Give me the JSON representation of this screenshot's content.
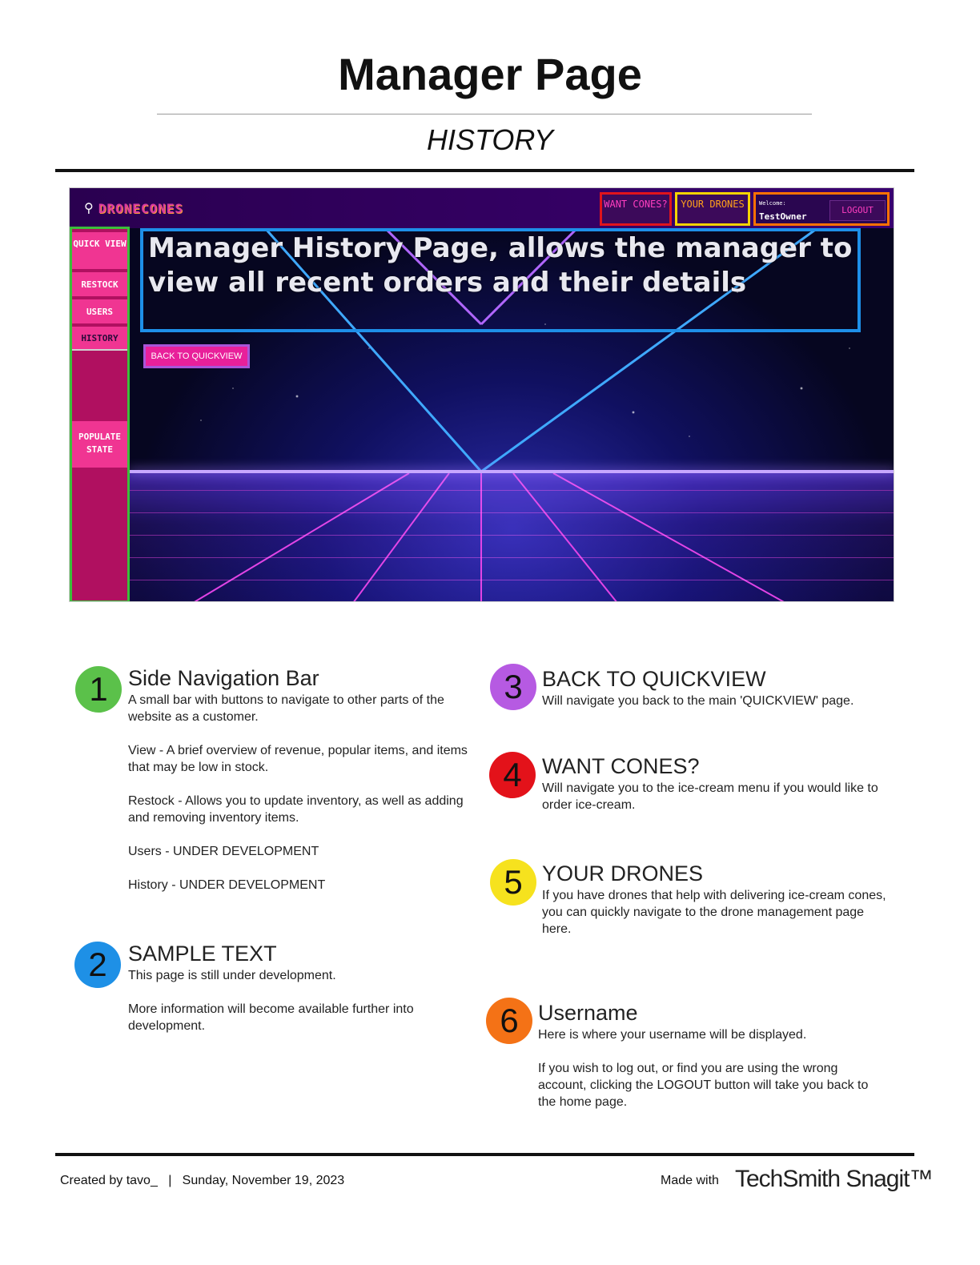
{
  "document": {
    "title": "Manager Page",
    "subtitle": "HISTORY"
  },
  "screenshot": {
    "logo_text": "DRONECONES",
    "logo_icon": "ice-cream-icon",
    "header": {
      "want_cones": "WANT CONES?",
      "your_drones": "YOUR DRONES",
      "welcome": "Welcome:",
      "username": "TestOwner",
      "logout": "LOGOUT"
    },
    "sidenav": {
      "quick_view": "QUICK VIEW",
      "restock": "RESTOCK",
      "users": "USERS",
      "history": "HISTORY",
      "populate_state": "POPULATE STATE"
    },
    "headline": "Manager History Page, allows the manager to view all recent orders and their details",
    "back_button": "BACK TO QUICKVIEW",
    "colors": {
      "nav_pink": "#f03592",
      "nav_dark": "#b01060",
      "highlight_green": "#3cbf3a",
      "highlight_blue": "#1e8fe8",
      "highlight_red": "#e0141c",
      "highlight_yellow": "#f5d300",
      "highlight_orange": "#ff7200",
      "highlight_purple": "#a855d8"
    }
  },
  "legend": [
    {
      "number": "1",
      "color": "#5bc14a",
      "title": "Side Navigation Bar",
      "paragraphs": [
        "A small bar with buttons to navigate to other parts of the website as a customer.",
        "View - A brief overview of revenue, popular items, and items that may be low in stock.",
        "Restock - Allows you to update inventory, as well as adding and removing inventory items.",
        "Users - UNDER DEVELOPMENT",
        "History - UNDER DEVELOPMENT"
      ]
    },
    {
      "number": "2",
      "color": "#1e90e6",
      "title": "SAMPLE TEXT",
      "paragraphs": [
        "This page is still under development.",
        "More information will become available further into development."
      ]
    },
    {
      "number": "3",
      "color": "#b65ae2",
      "title": "BACK TO QUICKVIEW",
      "paragraphs": [
        "Will navigate you back to the main 'QUICKVIEW' page."
      ]
    },
    {
      "number": "4",
      "color": "#e3121a",
      "title": "WANT CONES?",
      "paragraphs": [
        "Will navigate you to the ice-cream menu if you would like to order ice-cream."
      ]
    },
    {
      "number": "5",
      "color": "#f6e21e",
      "title": "YOUR DRONES",
      "paragraphs": [
        "If you have drones that help with delivering ice-cream cones, you can quickly navigate to the drone management page here."
      ]
    },
    {
      "number": "6",
      "color": "#f47216",
      "title": "Username",
      "paragraphs": [
        "Here is where your username will be displayed.",
        "If you wish to log out, or find you are using the wrong account, clicking the LOGOUT button will take you back to the home page."
      ]
    }
  ],
  "footer": {
    "created": "Created by tavo_   |   Sunday, November 19, 2023",
    "made_with": "Made with",
    "brand": "TechSmith Snagit™"
  }
}
